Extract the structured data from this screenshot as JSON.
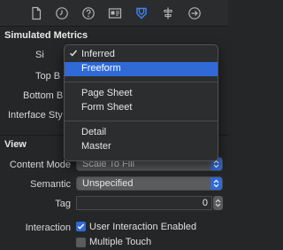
{
  "toolbar": {
    "icons": [
      "file-icon",
      "clock-icon",
      "help-icon",
      "identity-icon",
      "attributes-icon",
      "size-icon",
      "connections-icon"
    ],
    "active_color": "#3b82f6"
  },
  "simulated_metrics": {
    "title": "Simulated Metrics",
    "size_label": "Si",
    "top_bar_label": "Top B",
    "bottom_bar_label": "Bottom B",
    "interface_style_label": "Interface Sty"
  },
  "size_menu": {
    "selected": "Inferred",
    "groups": [
      [
        "Inferred",
        "Freeform"
      ],
      [
        "Page Sheet",
        "Form Sheet"
      ],
      [
        "Detail",
        "Master"
      ]
    ],
    "highlighted": "Freeform"
  },
  "view": {
    "title": "View",
    "content_mode_label": "Content Mode",
    "content_mode_value": "Scale To Fill",
    "semantic_label": "Semantic",
    "semantic_value": "Unspecified",
    "tag_label": "Tag",
    "tag_value": "0",
    "interaction_label": "Interaction",
    "user_interaction_label": "User Interaction Enabled",
    "user_interaction_checked": true,
    "multiple_touch_label": "Multiple Touch",
    "multiple_touch_checked": false
  }
}
